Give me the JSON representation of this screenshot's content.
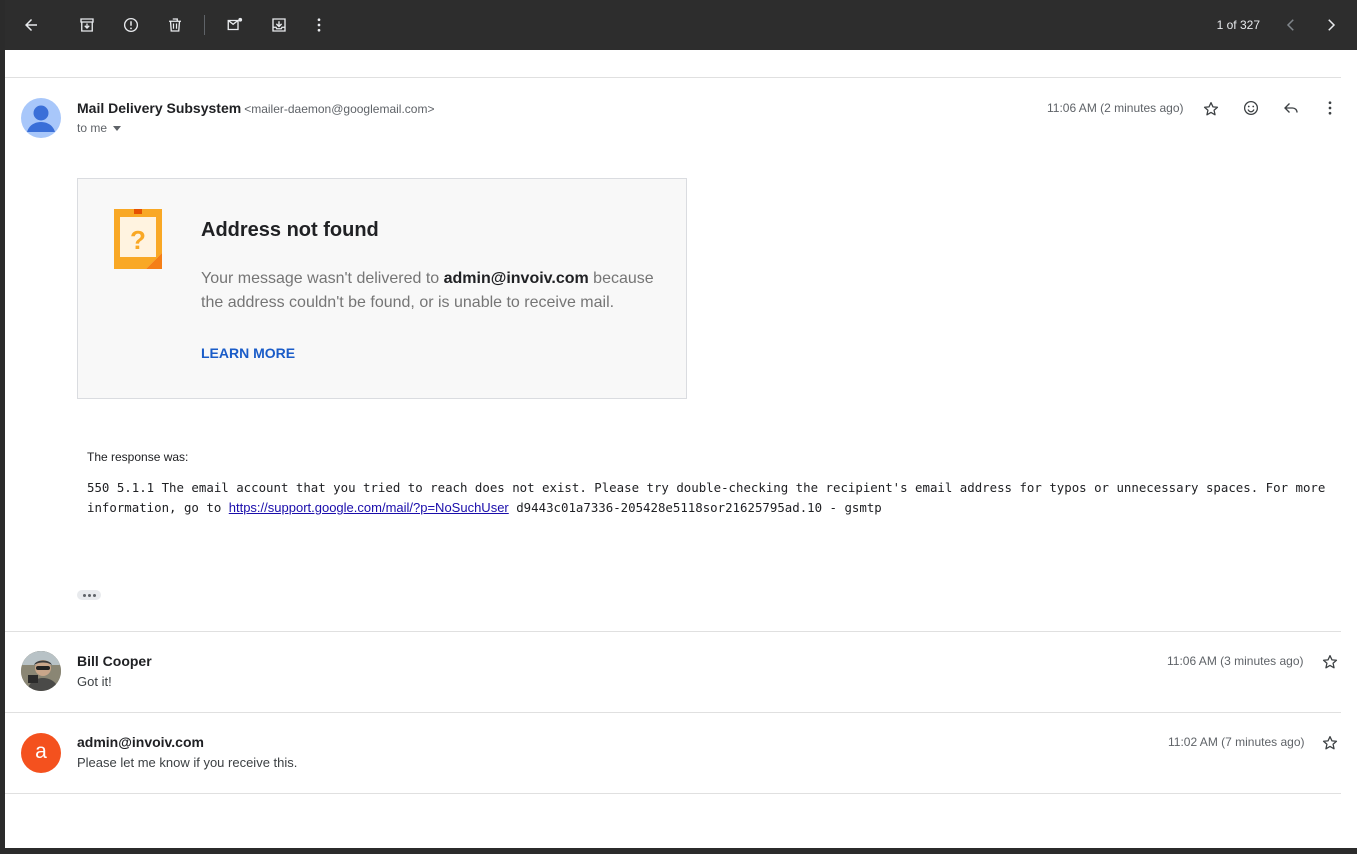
{
  "toolbar": {
    "back_icon": "arrow-left-icon",
    "archive_icon": "archive-icon",
    "report_icon": "report-spam-icon",
    "delete_icon": "trash-icon",
    "mark_unread_icon": "mark-unread-icon",
    "move_icon": "move-to-icon",
    "more_icon": "more-vert-icon",
    "pager": "1 of 327"
  },
  "message": {
    "sender_name": "Mail Delivery Subsystem",
    "sender_email": "<mailer-daemon@googlemail.com>",
    "to_label": "to me",
    "time": "11:06 AM (2 minutes ago)",
    "card": {
      "title": "Address not found",
      "body_prefix": "Your message wasn't delivered to",
      "body_address": "admin@invoiv.com",
      "body_suffix": "because the address couldn't be found, or is unable to receive mail.",
      "learn_more": "LEARN MORE"
    },
    "response_label": "The response was:",
    "response_part1": "550 5.1.1 The email account that you tried to reach does not exist. Please try double-checking the recipient's email address for typos or unnecessary spaces. For more information, go to ",
    "response_link": "https://support.google.com/mail/?p=NoSuchUser",
    "response_part2": " d9443c01a7336-205428e5118sor21625795ad.10 - gsmtp"
  },
  "thread": [
    {
      "sender_name": "Bill Cooper",
      "snippet": "Got it!",
      "time": "11:06 AM (3 minutes ago)"
    },
    {
      "sender_name": "admin@invoiv.com",
      "avatar_letter": "a",
      "snippet": "Please let me know if you receive this.",
      "time": "11:02 AM (7 minutes ago)"
    }
  ],
  "colors": {
    "toolbar_bg": "#2d2d2d",
    "link_blue": "#1a5cc8",
    "avatar_orange": "#f4511e",
    "avatar_blue": "#a8c7fa",
    "warning_orange": "#f9a825"
  }
}
